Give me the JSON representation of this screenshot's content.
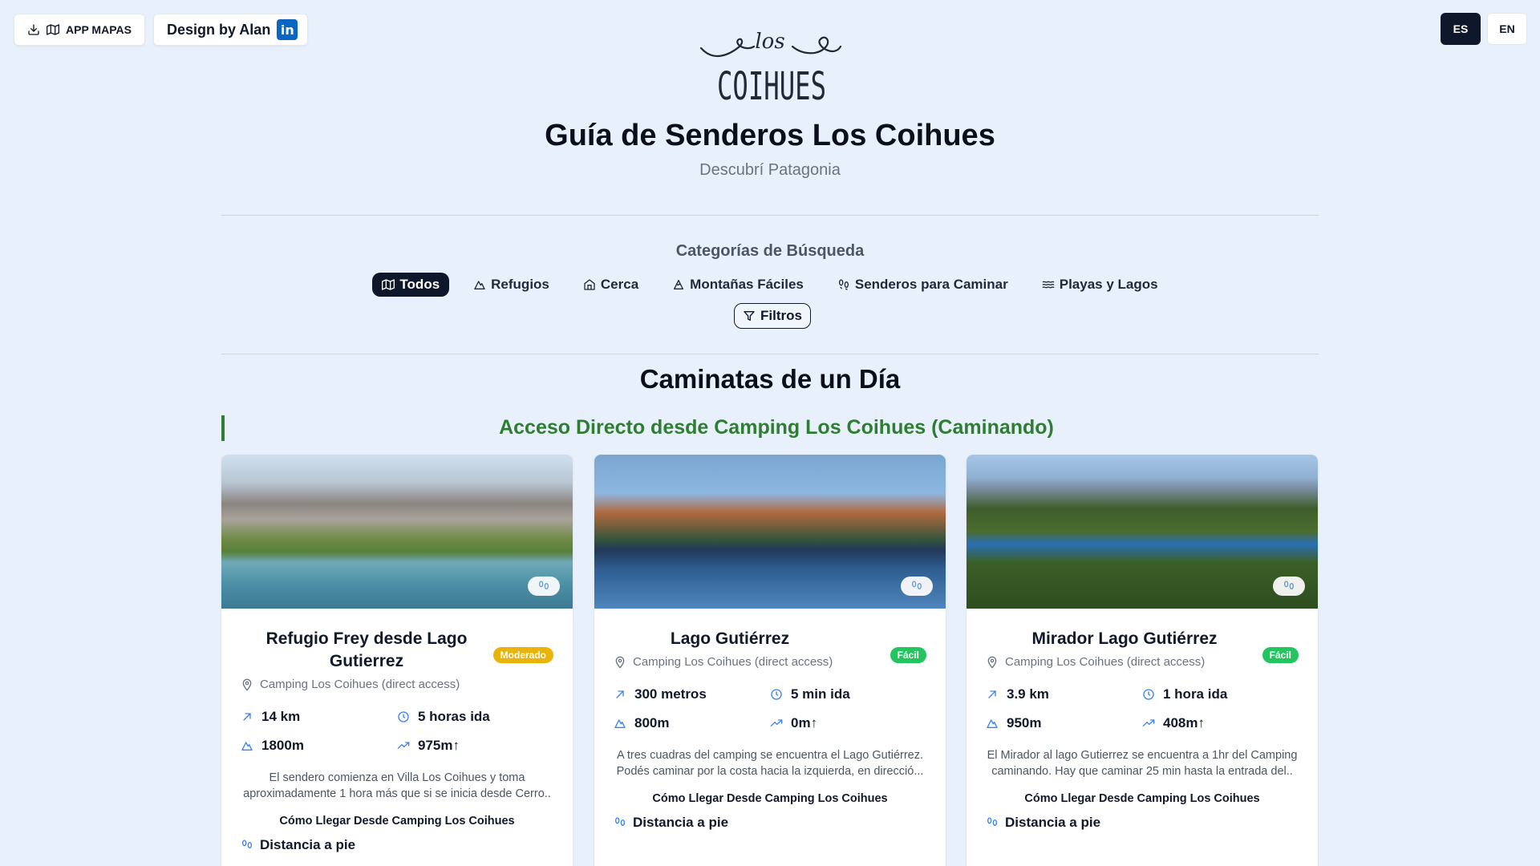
{
  "header": {
    "app_button": "APP MAPAS",
    "design_button": "Design by Alan",
    "linkedin_glyph": "in",
    "lang": [
      "ES",
      "EN"
    ],
    "logo_top": "los",
    "logo_main": "COIHUES",
    "title": "Guía de Senderos Los Coihues",
    "subtitle": "Descubrí Patagonia"
  },
  "categories": {
    "title": "Categorías de Búsqueda",
    "items": [
      {
        "label": "Todos",
        "icon": "map-icon"
      },
      {
        "label": "Refugios",
        "icon": "mountain-icon"
      },
      {
        "label": "Cerca",
        "icon": "home-icon"
      },
      {
        "label": "Montañas Fáciles",
        "icon": "mountain-snow-icon"
      },
      {
        "label": "Senderos para Caminar",
        "icon": "footprints-icon"
      },
      {
        "label": "Playas y Lagos",
        "icon": "waves-icon"
      }
    ],
    "filter_label": "Filtros"
  },
  "section": {
    "title": "Caminatas de un Día",
    "subtitle": "Acceso Directo desde Camping Los Coihues (Caminando)"
  },
  "cards": [
    {
      "title": "Refugio Frey desde Lago Gutierrez",
      "level": "Moderado",
      "location": "Camping Los Coihues (direct access)",
      "distance": "14 km",
      "time": "5 horas ida",
      "altitude": "1800m",
      "elevation": "975m↑",
      "description": "El sendero comienza en Villa Los Coihues y toma aproximadamente 1 hora más que si se inicia desde Cerro..",
      "howto": "Cómo Llegar Desde Camping Los Coihues",
      "access": "Distancia a pie"
    },
    {
      "title": "Lago Gutiérrez",
      "level": "Fácil",
      "location": "Camping Los Coihues (direct access)",
      "distance": "300 metros",
      "time": "5 min ida",
      "altitude": "800m",
      "elevation": "0m↑",
      "description": "A tres cuadras del camping se encuentra el Lago Gutiérrez. Podés caminar por la costa hacia la izquierda, en direcció...",
      "howto": "Cómo Llegar Desde Camping Los Coihues",
      "access": "Distancia a pie"
    },
    {
      "title": "Mirador Lago Gutiérrez",
      "level": "Fácil",
      "location": "Camping Los Coihues (direct access)",
      "distance": "3.9 km",
      "time": "1 hora ida",
      "altitude": "950m",
      "elevation": "408m↑",
      "description": "El Mirador al lago Gutierrez se encuentra a 1hr del Camping caminando. Hay que caminar 25 min hasta la entrada del..",
      "howto": "Cómo Llegar Desde Camping Los Coihues",
      "access": "Distancia a pie"
    }
  ],
  "colors": {
    "background": "#e8f1fb",
    "accent_dark": "#0f172a",
    "green": "#2e7d32",
    "moderate": "#eab308",
    "easy": "#22c55e"
  }
}
